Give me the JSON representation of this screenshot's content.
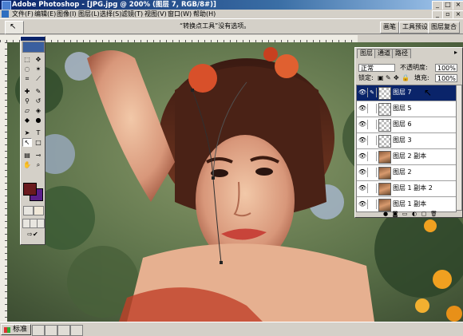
{
  "window": {
    "title": "Adobe Photoshop - [JPG.jpg @ 200% (图层 7, RGB/8#)]"
  },
  "menu": [
    "文件(F)",
    "编辑(E)",
    "图像(I)",
    "图层(L)",
    "选择(S)",
    "滤镜(T)",
    "视图(V)",
    "窗口(W)",
    "帮助(H)"
  ],
  "options_bar": {
    "hint": "“转换点工具”没有选项。",
    "palette_well": [
      "画笔",
      "工具预设",
      "图层复合"
    ]
  },
  "layers_panel": {
    "tabs": [
      "图层",
      "通道",
      "路径"
    ],
    "blend_mode": "正常",
    "opacity_label": "不透明度:",
    "opacity_value": "100%",
    "lock_label": "锁定:",
    "fill_label": "填充:",
    "fill_value": "100%",
    "layers": [
      {
        "name": "图层 7",
        "selected": true,
        "thumb": "checker"
      },
      {
        "name": "图层 5",
        "selected": false,
        "thumb": "checker"
      },
      {
        "name": "图层 6",
        "selected": false,
        "thumb": "checker"
      },
      {
        "name": "图层 3",
        "selected": false,
        "thumb": "checker"
      },
      {
        "name": "图层 2 副本",
        "selected": false,
        "thumb": "photo"
      },
      {
        "name": "图层 2",
        "selected": false,
        "thumb": "photo"
      },
      {
        "name": "图层 1 副本 2",
        "selected": false,
        "thumb": "photo"
      },
      {
        "name": "图层 1 副本",
        "selected": false,
        "thumb": "photo"
      }
    ]
  },
  "taskbar": {
    "start_label": "标准"
  },
  "colors": {
    "foreground": "#6a1a1e",
    "background": "#5a1e8a",
    "selection": "#0a246a"
  }
}
